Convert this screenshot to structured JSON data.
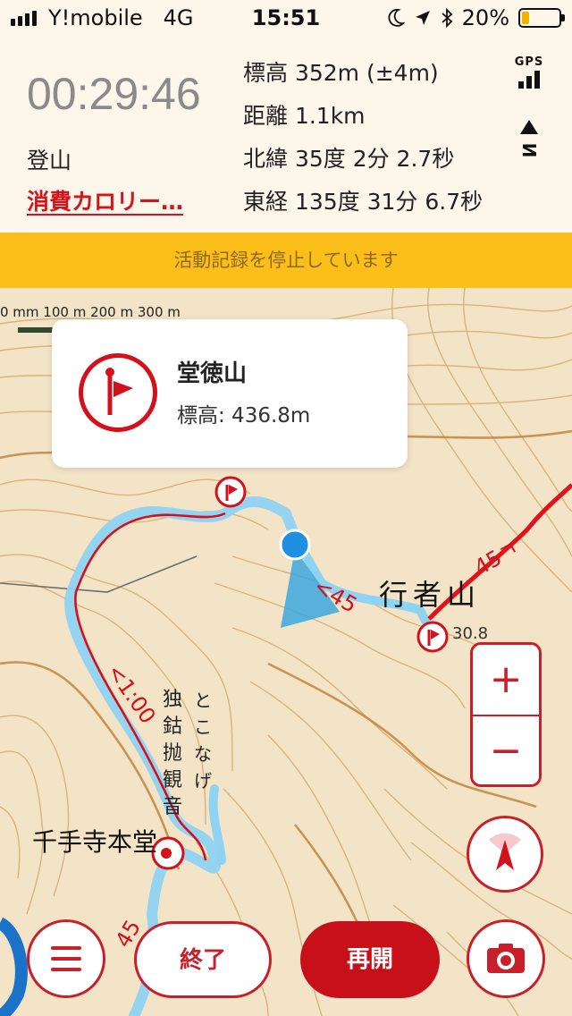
{
  "status_bar": {
    "carrier": "Y!mobile",
    "network": "4G",
    "time": "15:51",
    "battery_text": "20%",
    "battery_level": 0.2,
    "battery_color": "#f2b300",
    "icons": [
      "moon-icon",
      "location-arrow-icon",
      "bluetooth-icon"
    ]
  },
  "record": {
    "elapsed": "00:29:46",
    "activity": "登山",
    "calorie_link": "消費カロリー…",
    "altitude": "標高 352m (±4m)",
    "distance": "距離 1.1km",
    "latitude": "北緯 35度 2分 2.7秒",
    "longitude": "東経 135度 31分 6.7秒",
    "gps_label": "GPS",
    "north_label": "N"
  },
  "banner": {
    "text": "活動記録を停止しています",
    "color": "#fcbf1a"
  },
  "map": {
    "scale_labels": "0 mm   100 m  200 m  300 m",
    "peak_card": {
      "name": "堂徳山",
      "elevation": "標高: 436.8m"
    },
    "labels": {
      "gyoja": "行者山",
      "temple": "千手寺本堂",
      "trail_time": "<1:00",
      "trail_45_a": "<45",
      "trail_45_b": "45",
      "trail_45_c": "45ㄱ",
      "spot": "30.8",
      "vertical": [
        "独",
        "鈷",
        "抛",
        "観",
        "音"
      ],
      "vertical2": [
        "と",
        "こ",
        "な",
        "げ"
      ]
    },
    "route_color": "#8fd3f2",
    "trail_color": "#d3101b",
    "location_color": "#1e8fe3"
  },
  "controls": {
    "zoom_in": "+",
    "zoom_out": "−",
    "finish_button": "終了",
    "resume_button": "再開"
  }
}
